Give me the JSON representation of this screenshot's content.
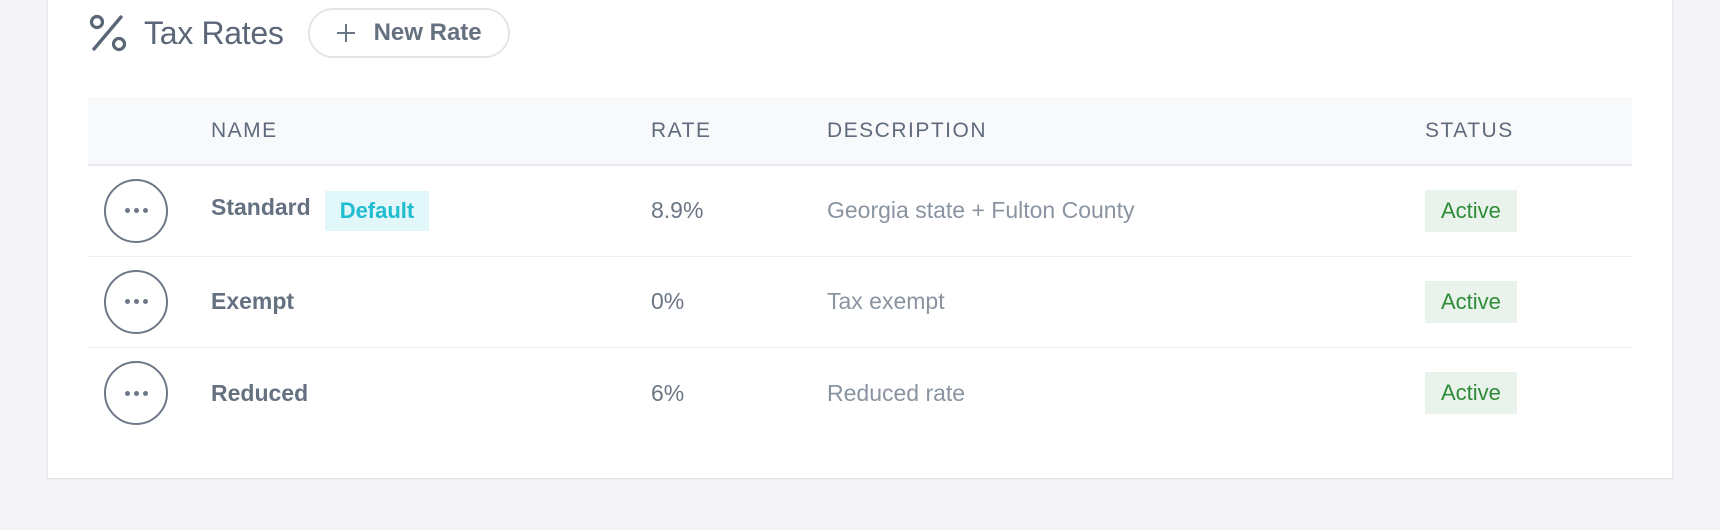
{
  "header": {
    "title": "Tax Rates",
    "new_button_label": "New Rate"
  },
  "table": {
    "columns": [
      "NAME",
      "RATE",
      "DESCRIPTION",
      "STATUS"
    ],
    "rows": [
      {
        "name": "Standard",
        "badge": "Default",
        "rate": "8.9%",
        "description": "Georgia state + Fulton County",
        "status": "Active"
      },
      {
        "name": "Exempt",
        "rate": "0%",
        "description": "Tax exempt",
        "status": "Active"
      },
      {
        "name": "Reduced",
        "rate": "6%",
        "description": "Reduced rate",
        "status": "Active"
      }
    ]
  },
  "icons": {
    "title": "percent-icon",
    "new_button": "plus-icon",
    "row_actions": "more-horizontal-icon"
  },
  "colors": {
    "default_badge_bg": "#e2f7fa",
    "default_badge_text": "#20bccf",
    "status_bg": "#e9f3ec",
    "status_text": "#2e8b38"
  }
}
